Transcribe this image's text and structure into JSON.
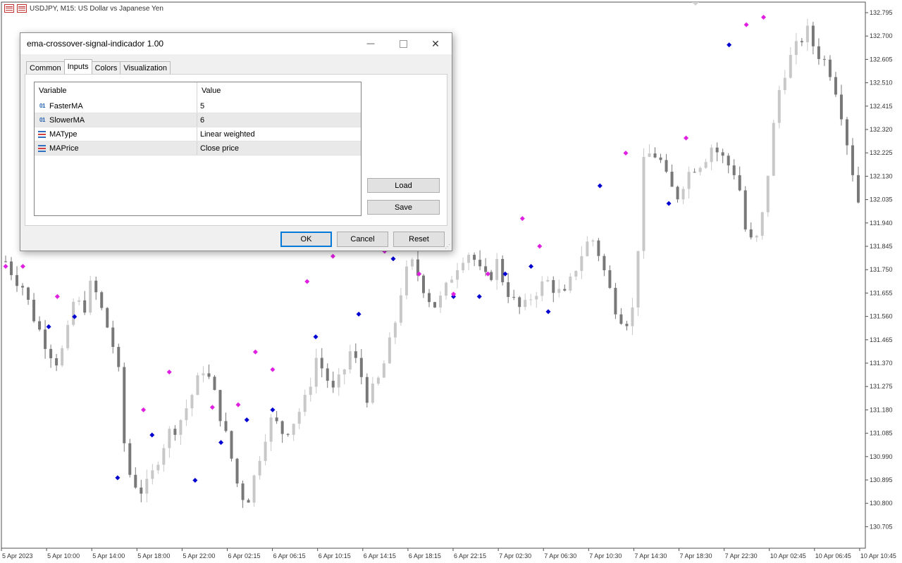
{
  "chart": {
    "symbol_title": "USDJPY, M15:  US Dollar vs Japanese Yen",
    "price_axis": [
      "132.795",
      "132.700",
      "132.605",
      "132.510",
      "132.415",
      "132.320",
      "132.225",
      "132.130",
      "132.035",
      "131.940",
      "131.845",
      "131.750",
      "131.655",
      "131.560",
      "131.465",
      "131.370",
      "131.275",
      "131.180",
      "131.085",
      "130.990",
      "130.895",
      "130.800",
      "130.705"
    ],
    "time_axis": [
      "5 Apr 2023",
      "5 Apr 10:00",
      "5 Apr 14:00",
      "5 Apr 18:00",
      "5 Apr 22:00",
      "6 Apr 02:15",
      "6 Apr 06:15",
      "6 Apr 10:15",
      "6 Apr 14:15",
      "6 Apr 18:15",
      "6 Apr 22:15",
      "7 Apr 02:30",
      "7 Apr 06:30",
      "7 Apr 10:30",
      "7 Apr 14:30",
      "7 Apr 18:30",
      "7 Apr 22:30",
      "10 Apr 02:45",
      "10 Apr 06:45",
      "10 Apr 10:45"
    ],
    "colors": {
      "bull": "#c8c8c8",
      "bear": "#787878",
      "buy_signal": "#0000d0",
      "sell_signal": "#e020e0",
      "grid": "#d8d8d8"
    }
  },
  "chart_data": {
    "type": "candlestick",
    "title": "USDJPY, M15:  US Dollar vs Japanese Yen",
    "ylim": [
      130.66,
      132.83
    ],
    "price_path": [
      131.8,
      131.74,
      131.7,
      131.6,
      131.52,
      131.45,
      131.4,
      131.48,
      131.66,
      131.6,
      131.72,
      131.62,
      131.52,
      131.4,
      130.98,
      130.92,
      130.88,
      130.95,
      131.05,
      131.12,
      131.15,
      131.22,
      131.3,
      131.38,
      131.3,
      131.18,
      131.05,
      130.9,
      130.84,
      130.96,
      131.1,
      131.18,
      131.12,
      131.14,
      131.2,
      131.26,
      131.42,
      131.36,
      131.28,
      131.34,
      131.44,
      131.38,
      131.26,
      131.3,
      131.4,
      131.52,
      131.7,
      131.8,
      131.74,
      131.66,
      131.62,
      131.68,
      131.76,
      131.82,
      131.84,
      131.76,
      131.72,
      131.8,
      131.7,
      131.64,
      131.6,
      131.66,
      131.7,
      131.72,
      131.68,
      131.66,
      131.76,
      131.84,
      131.9,
      131.82,
      131.7,
      131.6,
      131.56,
      131.62,
      132.18,
      132.24,
      132.2,
      132.1,
      132.06,
      132.14,
      132.18,
      132.2,
      132.26,
      132.22,
      132.18,
      132.14,
      131.9,
      131.86,
      132.0,
      132.3,
      132.52,
      132.6,
      132.66,
      132.72,
      132.64,
      132.6,
      132.54,
      132.4,
      132.22,
      132.04
    ],
    "buy_signals": [
      [
        5,
        131.54
      ],
      [
        8,
        131.58
      ],
      [
        13,
        130.94
      ],
      [
        17,
        131.11
      ],
      [
        22,
        130.93
      ],
      [
        25,
        131.08
      ],
      [
        28,
        131.17
      ],
      [
        31,
        131.21
      ],
      [
        36,
        131.5
      ],
      [
        41,
        131.59
      ],
      [
        45,
        131.81
      ],
      [
        52,
        131.66
      ],
      [
        55,
        131.66
      ],
      [
        58,
        131.75
      ],
      [
        61,
        131.78
      ],
      [
        63,
        131.6
      ],
      [
        69,
        132.1
      ],
      [
        77,
        132.03
      ],
      [
        84,
        132.66
      ]
    ],
    "sell_signals": [
      [
        0,
        131.78
      ],
      [
        2,
        131.78
      ],
      [
        6,
        131.66
      ],
      [
        16,
        131.21
      ],
      [
        19,
        131.36
      ],
      [
        24,
        131.22
      ],
      [
        27,
        131.23
      ],
      [
        29,
        131.44
      ],
      [
        31,
        131.37
      ],
      [
        35,
        131.72
      ],
      [
        38,
        131.82
      ],
      [
        44,
        131.84
      ],
      [
        48,
        131.75
      ],
      [
        52,
        131.67
      ],
      [
        56,
        131.75
      ],
      [
        60,
        131.97
      ],
      [
        62,
        131.86
      ],
      [
        72,
        132.23
      ],
      [
        79,
        132.29
      ],
      [
        86,
        132.74
      ],
      [
        88,
        132.77
      ]
    ]
  },
  "dialog": {
    "title": "ema-crossover-signal-indicador 1.00",
    "tabs": [
      "Common",
      "Inputs",
      "Colors",
      "Visualization"
    ],
    "table": {
      "col_variable": "Variable",
      "col_value": "Value",
      "rows": [
        {
          "icon_text": "01",
          "name": "FasterMA",
          "value": "5"
        },
        {
          "icon_text": "01",
          "name": "SlowerMA",
          "value": "6"
        },
        {
          "name": "MAType",
          "value": "Linear weighted"
        },
        {
          "name": "MAPrice",
          "value": "Close price"
        }
      ]
    },
    "buttons": {
      "load": "Load",
      "save": "Save",
      "ok": "OK",
      "cancel": "Cancel",
      "reset": "Reset"
    },
    "controls": {
      "minimize": "—",
      "close": "✕"
    }
  }
}
